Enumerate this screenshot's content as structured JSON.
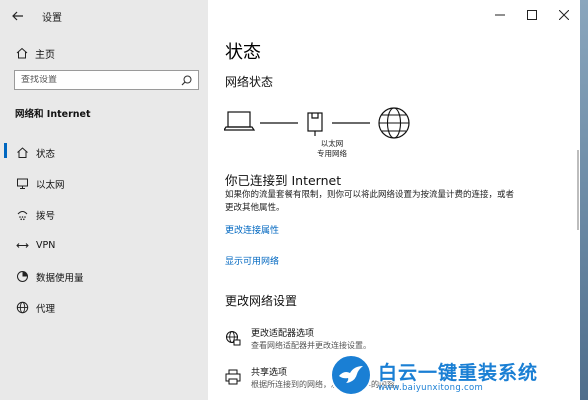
{
  "window": {
    "title": "设置",
    "controls": {
      "minimize": "—",
      "maximize": "☐",
      "close": "✕"
    }
  },
  "sidebar": {
    "back_icon": "back-arrow-icon",
    "home_label": "主页",
    "search": {
      "placeholder": "查找设置",
      "value": ""
    },
    "section_header": "网络和 Internet",
    "items": [
      {
        "label": "状态",
        "icon": "home-status-icon",
        "active": true
      },
      {
        "label": "以太网",
        "icon": "ethernet-icon",
        "active": false
      },
      {
        "label": "拨号",
        "icon": "dialup-icon",
        "active": false
      },
      {
        "label": "VPN",
        "icon": "vpn-icon",
        "active": false
      },
      {
        "label": "数据使用量",
        "icon": "data-usage-icon",
        "active": false
      },
      {
        "label": "代理",
        "icon": "globe-icon",
        "active": false
      }
    ]
  },
  "main": {
    "page_title": "状态",
    "network_status_title": "网络状态",
    "diagram": {
      "ethernet_caption_line1": "以太网",
      "ethernet_caption_line2": "专用网络"
    },
    "connected_title": "你已连接到 Internet",
    "connected_desc": "如果你的流量套餐有限制，则你可以将此网络设置为按流量计费的连接，或者更改其他属性。",
    "link_change_properties": "更改连接属性",
    "link_show_networks": "显示可用网络",
    "change_settings_title": "更改网络设置",
    "settings": [
      {
        "title": "更改适配器选项",
        "desc": "查看网络适配器并更改连接设置。",
        "icon": "adapter-globe-icon"
      },
      {
        "title": "共享选项",
        "desc": "根据所连接到的网络，决定要共享的内容。",
        "icon": "sharing-printer-icon"
      }
    ]
  },
  "watermark": {
    "brand": "白云一键重装系统",
    "url": "www.baiyunxitong.com",
    "accent": "#1a7fd4"
  },
  "colors": {
    "accent": "#0067c0",
    "sidebar_bg": "#e9e9e9"
  }
}
